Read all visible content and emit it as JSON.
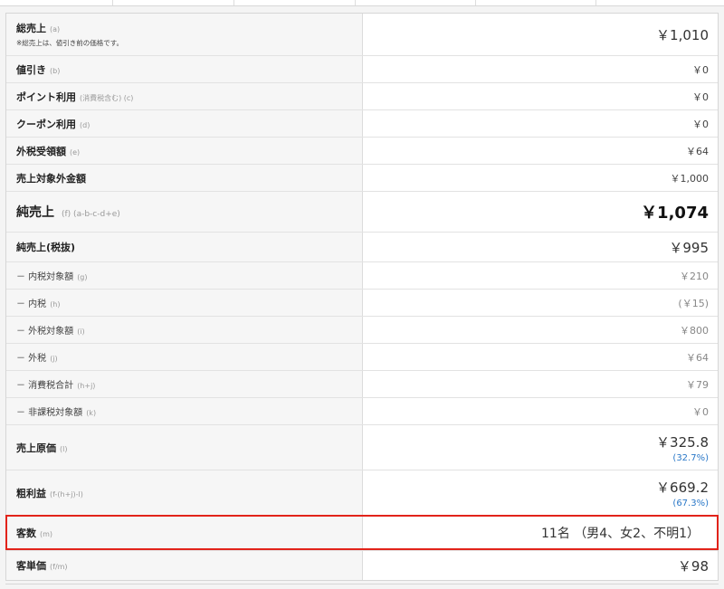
{
  "rows": [
    {
      "label": "総売上",
      "sub": "(a)",
      "note": "※総売上は、値引き前の価格です。",
      "value": "￥1,010"
    },
    {
      "label": "値引き",
      "sub": "(b)",
      "value": "￥0"
    },
    {
      "label": "ポイント利用",
      "sub": "(消費税含む) (c)",
      "value": "￥0"
    },
    {
      "label": "クーポン利用",
      "sub": "(d)",
      "value": "￥0"
    },
    {
      "label": "外税受領額",
      "sub": "(e)",
      "value": "￥64"
    },
    {
      "label": "売上対象外金額",
      "sub": "",
      "value": "￥1,000"
    },
    {
      "label": "純売上",
      "sub": "(f)  (a-b-c-d+e)",
      "value": "￥1,074"
    },
    {
      "label": "純売上(税抜)",
      "sub": "",
      "value": "￥995"
    },
    {
      "label": "－ 内税対象額",
      "sub": "(g)",
      "value": "￥210"
    },
    {
      "label": "－ 内税",
      "sub": "(h)",
      "value": "(￥15)"
    },
    {
      "label": "－ 外税対象額",
      "sub": "(i)",
      "value": "￥800"
    },
    {
      "label": "－ 外税",
      "sub": "(j)",
      "value": "￥64"
    },
    {
      "label": "－ 消費税合計",
      "sub": "(h+j)",
      "value": "￥79"
    },
    {
      "label": "－ 非課税対象額",
      "sub": "(k)",
      "value": "￥0"
    },
    {
      "label": "売上原価",
      "sub": "(l)",
      "value": "￥325.8",
      "pct": "(32.7%)"
    },
    {
      "label": "粗利益",
      "sub": "(f-(h+j)-l)",
      "value": "￥669.2",
      "pct": "(67.3%)"
    },
    {
      "label": "客数",
      "sub": "(m)",
      "value": "11名 （男4、女2、不明1）"
    },
    {
      "label": "客単価",
      "sub": "(f/m)",
      "value": "￥98"
    }
  ]
}
